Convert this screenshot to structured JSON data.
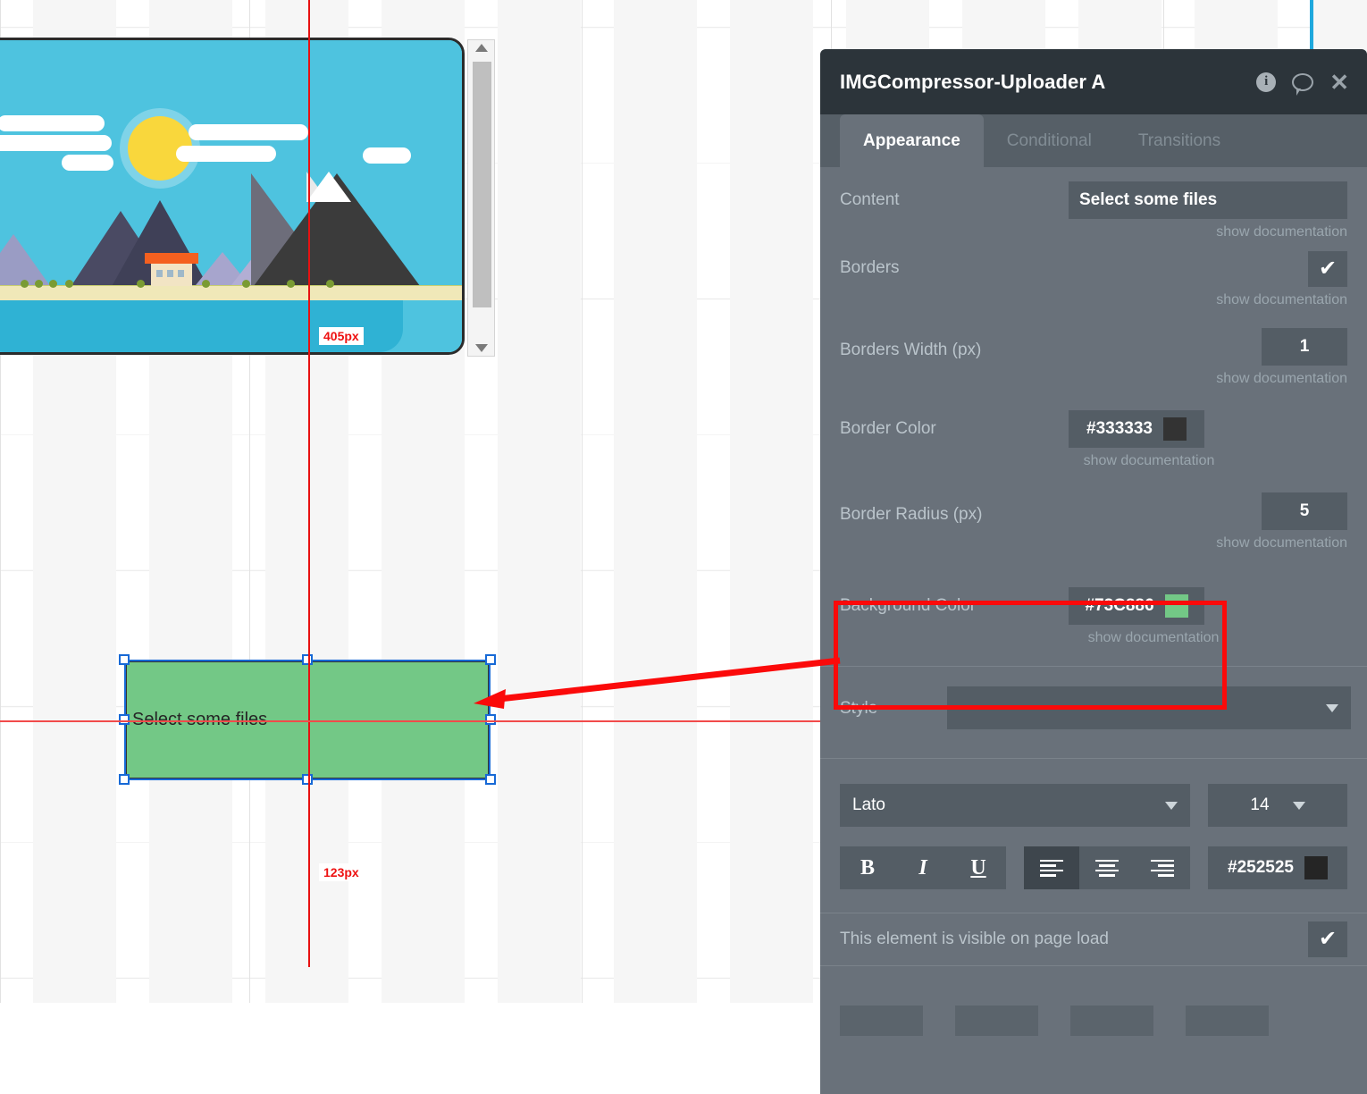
{
  "canvas": {
    "image_element": {
      "name": "landscape-illustration",
      "alt": "Flat illustration of mountains, sun, clouds and a lake",
      "scrollbar": {
        "up": "▲",
        "down": "▼"
      }
    },
    "selected_element": {
      "label": "Select some files",
      "background_color": "#73C886",
      "border_color": "#333333"
    },
    "guides": {
      "vertical_label": "405px",
      "horizontal_label": "123px",
      "color": "#EE1111"
    }
  },
  "panel": {
    "title": "IMGCompressor-Uploader A",
    "icons": {
      "info": "info-icon",
      "comment": "comment-icon",
      "close": "✕"
    },
    "tabs": [
      {
        "label": "Appearance",
        "active": true
      },
      {
        "label": "Conditional",
        "active": false
      },
      {
        "label": "Transitions",
        "active": false
      }
    ],
    "doc_link": "show documentation",
    "properties": [
      {
        "label": "Content",
        "value": "Select some files"
      },
      {
        "label": "Borders",
        "value": "✔"
      },
      {
        "label": "Borders Width (px)",
        "value": "1"
      },
      {
        "label": "Border Color",
        "value": "#333333",
        "swatch": "#333333"
      },
      {
        "label": "Border Radius (px)",
        "value": "5"
      },
      {
        "label": "Background Color",
        "value": "#73C886",
        "swatch": "#73C886"
      }
    ],
    "style": {
      "label": "Style",
      "value": ""
    },
    "font": {
      "family": "Lato",
      "size": "14",
      "bold": "B",
      "italic": "I",
      "underline": "U",
      "color": "#252525",
      "color_swatch": "#252525",
      "align_active": "left"
    },
    "visibility": {
      "label": "This element is visible on page load",
      "checked": "✔"
    },
    "footer_buttons": [
      "",
      "",
      "",
      ""
    ]
  }
}
